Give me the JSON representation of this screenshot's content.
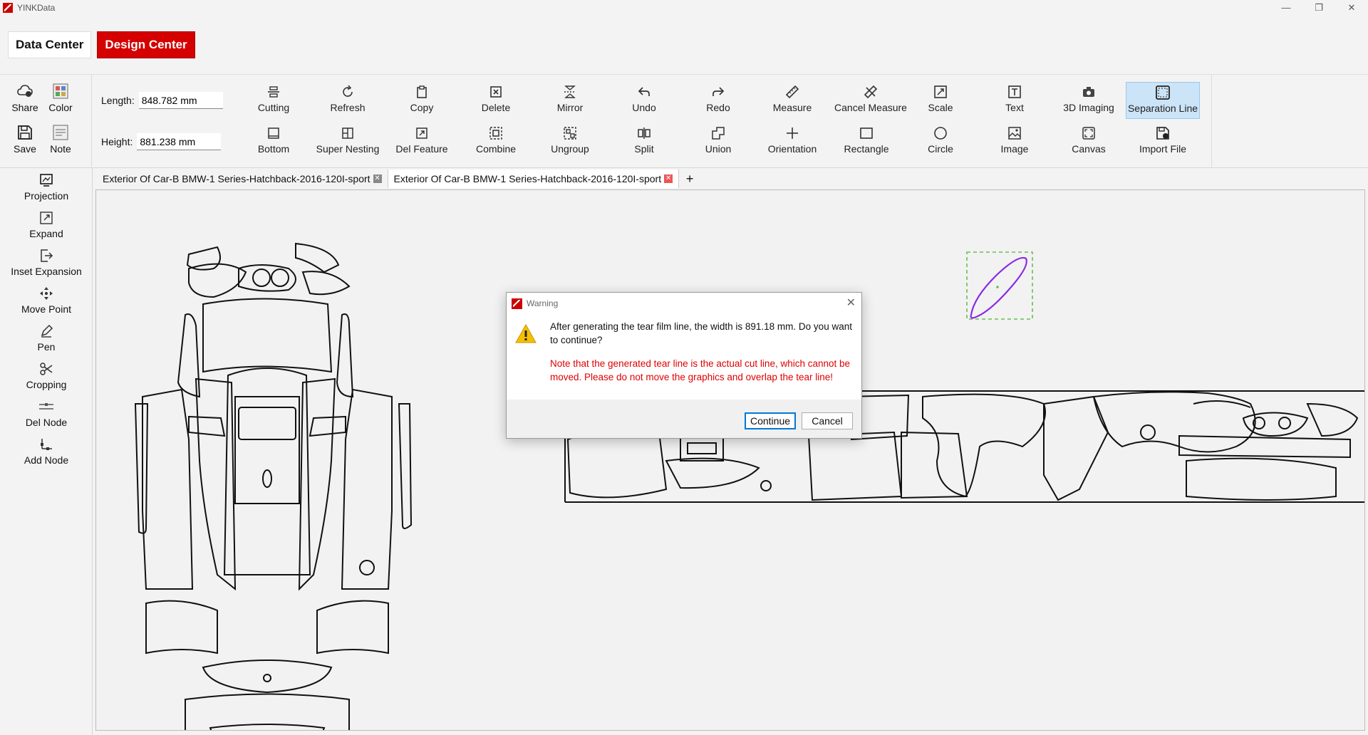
{
  "app": {
    "title": "YINKData"
  },
  "window_controls": {
    "minimize": "—",
    "maximize": "❐",
    "close": "✕"
  },
  "centers": [
    {
      "label": "Data Center",
      "active": false
    },
    {
      "label": "Design Center",
      "active": true
    }
  ],
  "ribbon": {
    "left_tools": {
      "share": "Share",
      "color": "Color",
      "save": "Save",
      "note": "Note"
    },
    "length_label": "Length:",
    "length_value": "848.782 mm",
    "height_label": "Height:",
    "height_value": "881.238 mm",
    "row1": [
      "Cutting",
      "Refresh",
      "Copy",
      "Delete",
      "Mirror",
      "Undo",
      "Redo",
      "Measure",
      "Cancel Measure",
      "Scale",
      "Text",
      "3D Imaging",
      "Separation Line"
    ],
    "row2": [
      "Bottom",
      "Super Nesting",
      "Del Feature",
      "Combine",
      "Ungroup",
      "Split",
      "Union",
      "Orientation",
      "Rectangle",
      "Circle",
      "Image",
      "Canvas",
      "Import File"
    ],
    "selected": "Separation Line"
  },
  "sidebar": [
    "Projection",
    "Expand",
    "Inset Expansion",
    "Move Point",
    "Pen",
    "Cropping",
    "Del Node",
    "Add Node"
  ],
  "tabs": [
    {
      "label": "Exterior Of Car-B BMW-1 Series-Hatchback-2016-120I-sport",
      "active": false
    },
    {
      "label": "Exterior Of Car-B BMW-1 Series-Hatchback-2016-120I-sport",
      "active": true
    }
  ],
  "tab_add": "+",
  "dialog": {
    "title": "Warning",
    "close": "✕",
    "message": "After generating the tear film line, the width is 891.18 mm. Do you want to continue?",
    "note": "Note that the generated tear line is the actual cut line, which cannot be moved. Please do not move the graphics and overlap the tear line!",
    "continue_label": "Continue",
    "cancel_label": "Cancel"
  },
  "colors": {
    "accent": "#d50000",
    "selection": "#cce4f7",
    "warning_text": "#e00000",
    "shape_highlight": "#8a2be2"
  }
}
